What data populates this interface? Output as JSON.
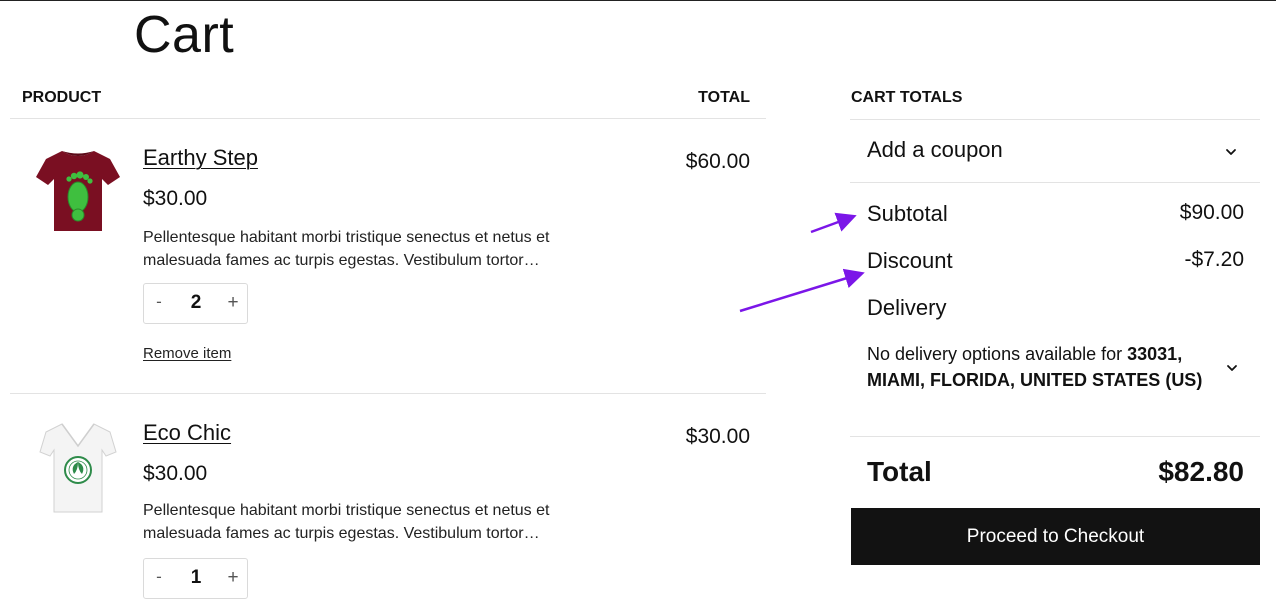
{
  "page": {
    "title": "Cart"
  },
  "cart": {
    "columns": {
      "product": "PRODUCT",
      "total": "TOTAL"
    },
    "items": [
      {
        "name": "Earthy Step",
        "price": "$30.00",
        "description": "Pellentesque habitant morbi tristique senectus et netus et malesuada fames ac turpis egestas. Vestibulum tortor…",
        "quantity": "2",
        "line_total": "$60.00",
        "remove_label": "Remove item",
        "image": "maroon-tshirt-footprint-graphic"
      },
      {
        "name": "Eco Chic",
        "price": "$30.00",
        "description": "Pellentesque habitant morbi tristique senectus et netus et malesuada fames ac turpis egestas. Vestibulum tortor…",
        "quantity": "1",
        "line_total": "$30.00",
        "image": "white-tshirt-eco-leaf-badge"
      }
    ],
    "qty_minus": "-",
    "qty_plus": "+"
  },
  "totals": {
    "title": "CART TOTALS",
    "coupon_label": "Add a coupon",
    "subtotal_label": "Subtotal",
    "subtotal_value": "$90.00",
    "discount_label": "Discount",
    "discount_value": "-$7.20",
    "delivery_label": "Delivery",
    "delivery_note_prefix": "No delivery options available for ",
    "delivery_note_address": "33031, MIAMI, FLORIDA, UNITED STATES (US)",
    "total_label": "Total",
    "total_value": "$82.80",
    "checkout_label": "Proceed to Checkout"
  },
  "annotations": {
    "arrow_color": "#7b16e8"
  },
  "colors": {
    "button_bg": "#121212",
    "text": "#111111",
    "divider": "#e3e3e3"
  }
}
